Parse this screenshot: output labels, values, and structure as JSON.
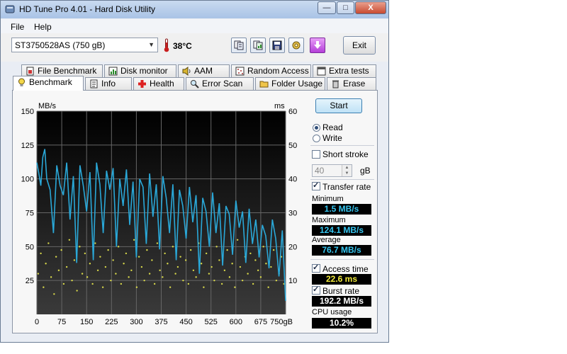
{
  "window": {
    "title": "HD Tune Pro 4.01 - Hard Disk Utility"
  },
  "window_controls": {
    "minimize": "—",
    "maximize": "□",
    "close": "X"
  },
  "menu": {
    "file": "File",
    "help": "Help"
  },
  "toolbar": {
    "drive": "ST3750528AS (750 gB)",
    "temperature": "38°C",
    "buttons": [
      "copy-info-icon",
      "copy-data-icon",
      "save-icon",
      "options-icon",
      "download-icon"
    ],
    "exit": "Exit"
  },
  "tabs_top": [
    "File Benchmark",
    "Disk monitor",
    "AAM",
    "Random Access",
    "Extra tests"
  ],
  "tabs_bottom": [
    "Benchmark",
    "Info",
    "Health",
    "Error Scan",
    "Folder Usage",
    "Erase"
  ],
  "active_tab": "Benchmark",
  "controls": {
    "start": "Start",
    "read": "Read",
    "write": "Write",
    "mode_selected": "Read",
    "short_stroke": "Short stroke",
    "short_stroke_checked": false,
    "short_stroke_value": "40",
    "short_stroke_unit": "gB",
    "transfer_rate": "Transfer rate",
    "transfer_rate_checked": true,
    "minimum_label": "Minimum",
    "minimum_value": "1.5 MB/s",
    "maximum_label": "Maximum",
    "maximum_value": "124.1 MB/s",
    "average_label": "Average",
    "average_value": "76.7 MB/s",
    "access_time": "Access time",
    "access_time_checked": true,
    "access_time_value": "22.6 ms",
    "burst_rate": "Burst rate",
    "burst_rate_checked": true,
    "burst_rate_value": "192.2 MB/s",
    "cpu_usage_label": "CPU usage",
    "cpu_usage_value": "10.2%"
  },
  "chart_data": {
    "type": "line",
    "title": "",
    "background": "#000000",
    "grid": true,
    "xlabel": "",
    "x_unit": "gB",
    "y_left_unit": "MB/s",
    "y_right_unit": "ms",
    "xlim": [
      0,
      750
    ],
    "ylim_left": [
      0,
      150
    ],
    "ylim_right": [
      0,
      60
    ],
    "x_ticks": [
      0,
      75,
      150,
      225,
      300,
      375,
      450,
      525,
      600,
      675,
      750
    ],
    "y_left_ticks": [
      25,
      50,
      75,
      100,
      125,
      150
    ],
    "y_right_ticks": [
      10,
      20,
      30,
      40,
      50,
      60
    ],
    "series": [
      {
        "name": "Transfer rate",
        "axis": "left",
        "color": "#2aa8d8",
        "x": [
          0,
          6,
          12,
          18,
          24,
          30,
          40,
          50,
          60,
          70,
          80,
          90,
          100,
          110,
          120,
          130,
          140,
          150,
          160,
          170,
          180,
          190,
          200,
          210,
          220,
          230,
          240,
          250,
          260,
          270,
          280,
          290,
          300,
          310,
          320,
          330,
          340,
          350,
          360,
          370,
          380,
          390,
          400,
          410,
          420,
          430,
          440,
          450,
          460,
          470,
          480,
          490,
          500,
          510,
          520,
          530,
          540,
          550,
          560,
          570,
          580,
          590,
          600,
          610,
          620,
          630,
          640,
          650,
          660,
          670,
          680,
          690,
          700,
          710,
          720,
          730,
          740,
          750
        ],
        "y": [
          112,
          104,
          95,
          116,
          122,
          100,
          92,
          60,
          110,
          95,
          88,
          112,
          70,
          102,
          38,
          110,
          95,
          76,
          105,
          40,
          112,
          96,
          60,
          106,
          92,
          108,
          50,
          100,
          80,
          107,
          66,
          98,
          42,
          100,
          94,
          52,
          104,
          72,
          96,
          48,
          102,
          86,
          60,
          96,
          40,
          92,
          80,
          56,
          94,
          68,
          88,
          30,
          86,
          76,
          50,
          90,
          60,
          82,
          36,
          80,
          74,
          44,
          84,
          64,
          76,
          38,
          78,
          52,
          70,
          42,
          66,
          58,
          34,
          70,
          56,
          28,
          62,
          10
        ]
      },
      {
        "name": "Access time",
        "axis": "right",
        "color": "#d8d84a",
        "x": [
          4,
          12,
          20,
          27,
          35,
          43,
          52,
          58,
          66,
          74,
          81,
          90,
          98,
          106,
          113,
          121,
          129,
          137,
          145,
          152,
          160,
          168,
          176,
          184,
          191,
          199,
          207,
          215,
          223,
          230,
          238,
          246,
          254,
          262,
          269,
          277,
          285,
          293,
          301,
          308,
          316,
          324,
          332,
          340,
          347,
          355,
          363,
          371,
          379,
          386,
          394,
          402,
          410,
          418,
          425,
          433,
          441,
          449,
          457,
          464,
          472,
          480,
          488,
          496,
          503,
          511,
          519,
          527,
          535,
          542,
          550,
          558,
          566,
          574,
          581,
          589,
          597,
          605,
          613,
          620,
          628,
          636,
          644,
          652,
          659,
          667,
          675,
          683,
          691,
          698,
          706,
          714,
          722,
          730,
          737,
          745
        ],
        "y": [
          12,
          18,
          8,
          15,
          21,
          11,
          6,
          17,
          13,
          19,
          9,
          14,
          22,
          10,
          16,
          7,
          20,
          12,
          18,
          11,
          15,
          9,
          21,
          13,
          17,
          8,
          14,
          19,
          10,
          16,
          12,
          20,
          9,
          15,
          18,
          11,
          13,
          22,
          8,
          17,
          14,
          10,
          19,
          12,
          16,
          9,
          21,
          13,
          11,
          18,
          15,
          8,
          20,
          12,
          14,
          17,
          10,
          16,
          9,
          19,
          13,
          11,
          21,
          15,
          8,
          18,
          12,
          14,
          10,
          20,
          16,
          9,
          13,
          19,
          11,
          15,
          8,
          22,
          14,
          10,
          17,
          12,
          18,
          9,
          16,
          13,
          11,
          20,
          15,
          8,
          14,
          19,
          10,
          12,
          17,
          9
        ]
      }
    ]
  }
}
